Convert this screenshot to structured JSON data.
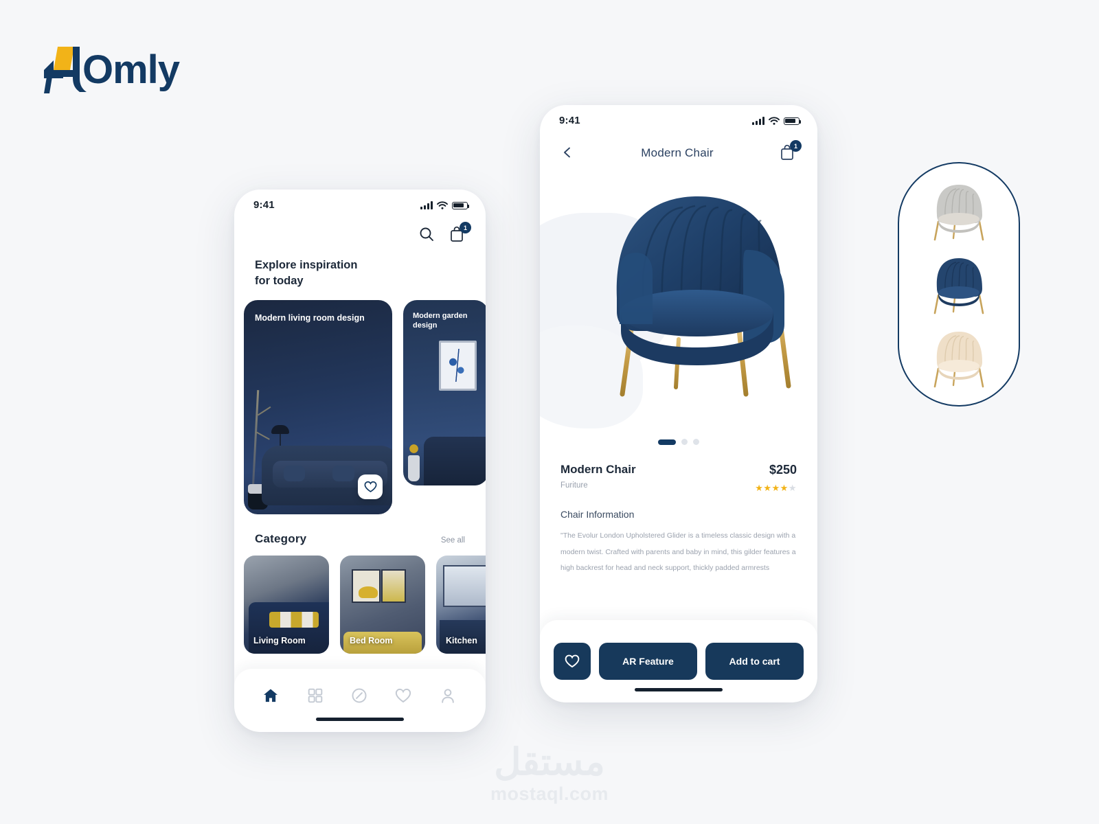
{
  "brand": {
    "name": "Omly",
    "mark_icon": "chair-logo-icon",
    "navy": "#133A63",
    "yellow": "#F2B318"
  },
  "home_screen": {
    "status_bar": {
      "time": "9:41",
      "signal_icon": "signal-bars-icon",
      "wifi_icon": "wifi-icon",
      "battery_icon": "battery-icon"
    },
    "actions": {
      "search_icon": "search-icon",
      "bag_icon": "shopping-bag-icon",
      "bag_badge": "1"
    },
    "heading": "Explore inspiration\nfor today",
    "inspiration": [
      {
        "title": "Modern living room design",
        "favorite_icon": "heart-icon"
      },
      {
        "title": "Modern garden design"
      }
    ],
    "category": {
      "title": "Category",
      "see_all": "See all",
      "items": [
        {
          "label": "Living Room"
        },
        {
          "label": "Bed Room"
        },
        {
          "label": "Kitchen"
        }
      ]
    },
    "tabbar": [
      {
        "name": "home-tab",
        "icon": "home-icon",
        "active": true
      },
      {
        "name": "categories-tab",
        "icon": "grid-icon",
        "active": false
      },
      {
        "name": "explore-tab",
        "icon": "compass-icon",
        "active": false
      },
      {
        "name": "favorites-tab",
        "icon": "heart-icon",
        "active": false
      },
      {
        "name": "profile-tab",
        "icon": "user-icon",
        "active": false
      }
    ]
  },
  "detail_screen": {
    "status_bar": {
      "time": "9:41",
      "signal_icon": "signal-bars-icon",
      "wifi_icon": "wifi-icon",
      "battery_icon": "battery-icon"
    },
    "nav": {
      "back_icon": "chevron-left-icon",
      "title": "Modern Chair",
      "bag_icon": "shopping-bag-icon",
      "bag_badge": "1"
    },
    "gallery": {
      "image": "navy-velvet-tub-chair",
      "page_count": 3,
      "active_page": 1
    },
    "product": {
      "name": "Modern Chair",
      "price": "$250",
      "category": "Furiture",
      "rating": 4,
      "rating_max": 5,
      "stars_filled": "★★★★",
      "stars_empty": "★"
    },
    "info": {
      "title": "Chair Information",
      "body": "\"The Evolur London Upholstered Glider is a timeless classic design with a modern twist. Crafted with parents and baby in mind, this gilder features a high backrest for head and neck support, thickly padded armrests"
    },
    "cta": {
      "favorite_icon": "heart-icon",
      "ar_label": "AR Feature",
      "cart_label": "Add to cart"
    }
  },
  "variant_panel": {
    "items": [
      {
        "name": "chair-variant-grey",
        "color": "#c9c9c6",
        "legs": "#c8a45c"
      },
      {
        "name": "chair-variant-navy",
        "color": "#24456e",
        "legs": "#c8a45c"
      },
      {
        "name": "chair-variant-cream",
        "color": "#efdfc8",
        "legs": "#c8a45c"
      }
    ]
  },
  "watermark": {
    "arabic": "مستقل",
    "latin": "mostaql.com"
  }
}
